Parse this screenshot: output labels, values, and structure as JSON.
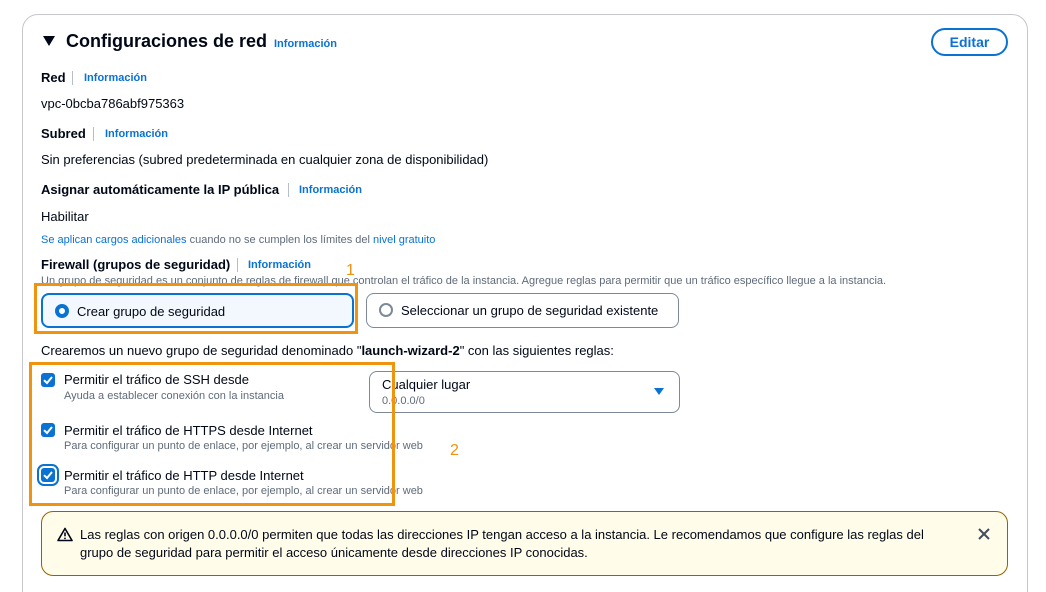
{
  "section": {
    "title": "Configuraciones de red",
    "info_label": "Información",
    "edit_label": "Editar"
  },
  "network": {
    "label": "Red",
    "info_label": "Información",
    "value": "vpc-0bcba786abf975363"
  },
  "subnet": {
    "label": "Subred",
    "info_label": "Información",
    "value": "Sin preferencias (subred predeterminada en cualquier zona de disponibilidad)"
  },
  "public_ip": {
    "label": "Asignar automáticamente la IP pública",
    "info_label": "Información",
    "value": "Habilitar",
    "note_link": "Se aplican cargos adicionales",
    "note_text": " cuando no se cumplen los límites del ",
    "note_link2": "nivel gratuito"
  },
  "firewall": {
    "label": "Firewall (grupos de seguridad)",
    "info_label": "Información",
    "description": "Un grupo de seguridad es un conjunto de reglas de firewall que controlan el tráfico de la instancia. Agregue reglas para permitir que un tráfico específico llegue a la instancia.",
    "option_create": "Crear grupo de seguridad",
    "option_existing": "Seleccionar un grupo de seguridad existente",
    "selected": "create",
    "create_msg_prefix": "Crearemos un nuevo grupo de seguridad denominado \"",
    "create_msg_name": "launch-wizard-2",
    "create_msg_suffix": "\" con las siguientes reglas:"
  },
  "rules": [
    {
      "label": "Permitir el tráfico de SSH desde",
      "desc": "Ayuda a establecer conexión con la instancia",
      "checked": true
    },
    {
      "label": "Permitir el tráfico de HTTPS desde Internet",
      "desc": "Para configurar un punto de enlace, por ejemplo, al crear un servidor web",
      "checked": true
    },
    {
      "label": "Permitir el tráfico de HTTP desde Internet",
      "desc": "Para configurar un punto de enlace, por ejemplo, al crear un servidor web",
      "checked": true
    }
  ],
  "ssh_source": {
    "value": "Cualquier lugar",
    "sub": "0.0.0.0/0"
  },
  "warning": {
    "text": "Las reglas con origen 0.0.0.0/0 permiten que todas las direcciones IP tengan acceso a la instancia. Le recomendamos que configure las reglas del grupo de seguridad para permitir el acceso únicamente desde direcciones IP conocidas."
  },
  "annotations": {
    "one": "1",
    "two": "2"
  },
  "colors": {
    "accent": "#0972d3",
    "highlight": "#f0930e",
    "warning_bg": "#fffce9",
    "warning_border": "#8d6605"
  }
}
